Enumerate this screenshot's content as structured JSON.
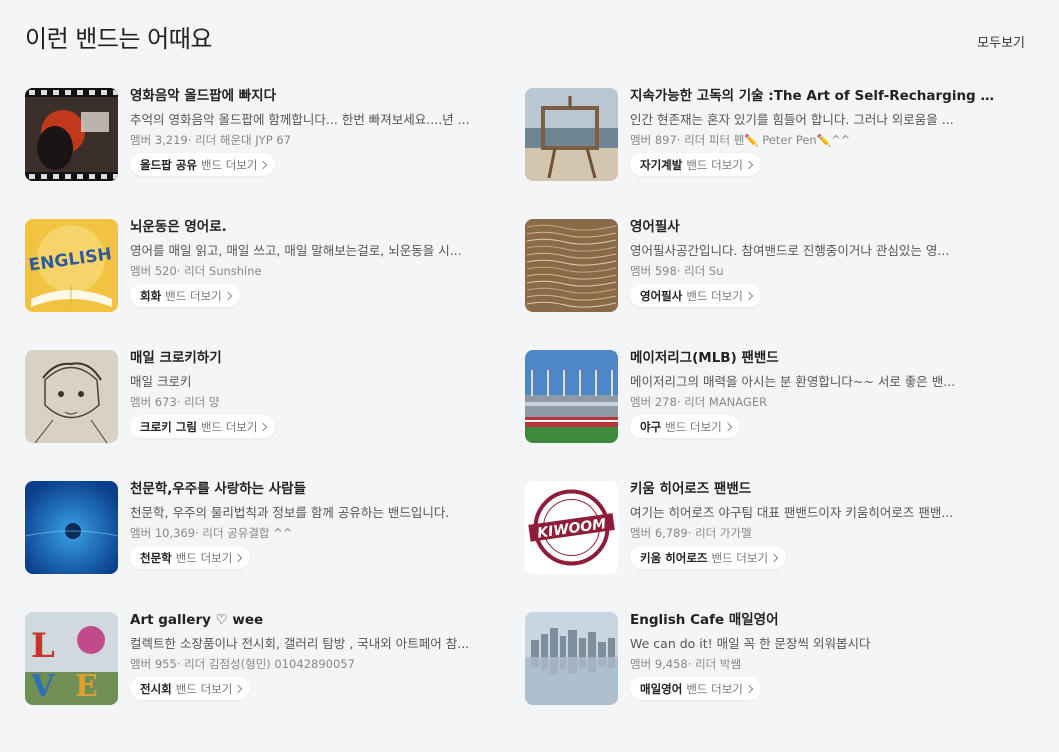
{
  "section": {
    "title": "이런 밴드는 어때요",
    "see_all": "모두보기"
  },
  "bands": [
    {
      "name": "영화음악 올드팝에 빠지다",
      "desc": "추억의 영화음악 올드팝에 함께합니다... 한번 빠져보세요....년 ...",
      "members": "멤버 3,219",
      "leader": "리더 해운대 JYP 67",
      "tag": "올드팝 공유",
      "more": "밴드 더보기",
      "thumb": "film-portrait"
    },
    {
      "name": "지속가능한 고독의 기술 :The Art of Self-Recharging P...",
      "desc": "인간 현존재는 혼자 있기를 힘들어 합니다. 그러나 외로움을 ...",
      "members": "멤버 897",
      "leader": "리더 피터 펜✏️ Peter Pen✏️^^",
      "tag": "자기계발",
      "more": "밴드 더보기",
      "thumb": "beach-frame"
    },
    {
      "name": "뇌운동은 영어로.",
      "desc": "영어를 매일 읽고, 매일 쓰고, 매일 말해보는걸로, 뇌운동을 시...",
      "members": "멤버 520",
      "leader": "리더 Sunshine",
      "tag": "회화",
      "more": "밴드 더보기",
      "thumb": "english-book"
    },
    {
      "name": "영어필사",
      "desc": "영어필사공간입니다. 참여밴드로 진행중이거나 관심있는 영...",
      "members": "멤버 598",
      "leader": "리더 Su",
      "tag": "영어필사",
      "more": "밴드 더보기",
      "thumb": "handwriting"
    },
    {
      "name": "매일 크로키하기",
      "desc": "매일 크로키",
      "members": "멤버 673",
      "leader": "리더 먕",
      "tag": "크로키 그림",
      "more": "밴드 더보기",
      "thumb": "sketch"
    },
    {
      "name": "메이저리그(MLB) 팬밴드",
      "desc": "메이저리그의 매력을 아시는 분 환영합니다~~ 서로 좋은 밴...",
      "members": "멤버 278",
      "leader": "리더 MANAGER",
      "tag": "야구",
      "more": "밴드 더보기",
      "thumb": "stadium"
    },
    {
      "name": "천문학,우주를 사랑하는 사람들",
      "desc": "천문학, 우주의 물리법칙과 정보를 함께 공유하는 밴드입니다.",
      "members": "멤버 10,369",
      "leader": "리더 공유결합 ^^",
      "tag": "천문학",
      "more": "밴드 더보기",
      "thumb": "space-blue"
    },
    {
      "name": "키움 히어로즈 팬밴드",
      "desc": "여기는 히어로즈 야구팀 대표 팬밴드이자 키움히어로즈 팬밴...",
      "members": "멤버 6,789",
      "leader": "리더 가가멜",
      "tag": "키움 히어로즈",
      "more": "밴드 더보기",
      "thumb": "kiwoom-logo",
      "logo_text": "KIWOOM"
    },
    {
      "name": "Art gallery ♡ wee",
      "desc": "컬렉트한 소장품이나 전시회, 갤러리 탐방 , 국내외 아트페어 참...",
      "members": "멤버 955",
      "leader": "리더 김점성(형민) 01042890057",
      "tag": "전시회",
      "more": "밴드 더보기",
      "thumb": "love-sculpture",
      "logo_text": "LOVE"
    },
    {
      "name": "English Cafe 매일영어",
      "desc": "We can do it! 매일 꼭 한 문장씩 외워봅시다",
      "members": "멤버 9,458",
      "leader": "리더 박쌤",
      "tag": "매일영어",
      "more": "밴드 더보기",
      "thumb": "city-harbor"
    }
  ],
  "colors": {
    "background": "#f4f5f7",
    "pill": "#ffffff",
    "meta_text": "#888888"
  }
}
